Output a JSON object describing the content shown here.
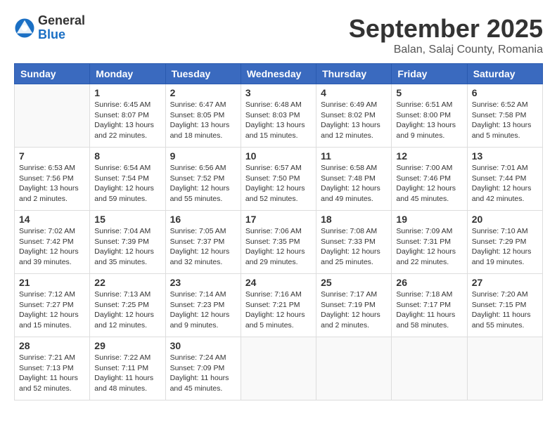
{
  "header": {
    "logo_general": "General",
    "logo_blue": "Blue",
    "month_title": "September 2025",
    "location": "Balan, Salaj County, Romania"
  },
  "days_of_week": [
    "Sunday",
    "Monday",
    "Tuesday",
    "Wednesday",
    "Thursday",
    "Friday",
    "Saturday"
  ],
  "weeks": [
    [
      {
        "day": "",
        "info": ""
      },
      {
        "day": "1",
        "info": "Sunrise: 6:45 AM\nSunset: 8:07 PM\nDaylight: 13 hours\nand 22 minutes."
      },
      {
        "day": "2",
        "info": "Sunrise: 6:47 AM\nSunset: 8:05 PM\nDaylight: 13 hours\nand 18 minutes."
      },
      {
        "day": "3",
        "info": "Sunrise: 6:48 AM\nSunset: 8:03 PM\nDaylight: 13 hours\nand 15 minutes."
      },
      {
        "day": "4",
        "info": "Sunrise: 6:49 AM\nSunset: 8:02 PM\nDaylight: 13 hours\nand 12 minutes."
      },
      {
        "day": "5",
        "info": "Sunrise: 6:51 AM\nSunset: 8:00 PM\nDaylight: 13 hours\nand 9 minutes."
      },
      {
        "day": "6",
        "info": "Sunrise: 6:52 AM\nSunset: 7:58 PM\nDaylight: 13 hours\nand 5 minutes."
      }
    ],
    [
      {
        "day": "7",
        "info": "Sunrise: 6:53 AM\nSunset: 7:56 PM\nDaylight: 13 hours\nand 2 minutes."
      },
      {
        "day": "8",
        "info": "Sunrise: 6:54 AM\nSunset: 7:54 PM\nDaylight: 12 hours\nand 59 minutes."
      },
      {
        "day": "9",
        "info": "Sunrise: 6:56 AM\nSunset: 7:52 PM\nDaylight: 12 hours\nand 55 minutes."
      },
      {
        "day": "10",
        "info": "Sunrise: 6:57 AM\nSunset: 7:50 PM\nDaylight: 12 hours\nand 52 minutes."
      },
      {
        "day": "11",
        "info": "Sunrise: 6:58 AM\nSunset: 7:48 PM\nDaylight: 12 hours\nand 49 minutes."
      },
      {
        "day": "12",
        "info": "Sunrise: 7:00 AM\nSunset: 7:46 PM\nDaylight: 12 hours\nand 45 minutes."
      },
      {
        "day": "13",
        "info": "Sunrise: 7:01 AM\nSunset: 7:44 PM\nDaylight: 12 hours\nand 42 minutes."
      }
    ],
    [
      {
        "day": "14",
        "info": "Sunrise: 7:02 AM\nSunset: 7:42 PM\nDaylight: 12 hours\nand 39 minutes."
      },
      {
        "day": "15",
        "info": "Sunrise: 7:04 AM\nSunset: 7:39 PM\nDaylight: 12 hours\nand 35 minutes."
      },
      {
        "day": "16",
        "info": "Sunrise: 7:05 AM\nSunset: 7:37 PM\nDaylight: 12 hours\nand 32 minutes."
      },
      {
        "day": "17",
        "info": "Sunrise: 7:06 AM\nSunset: 7:35 PM\nDaylight: 12 hours\nand 29 minutes."
      },
      {
        "day": "18",
        "info": "Sunrise: 7:08 AM\nSunset: 7:33 PM\nDaylight: 12 hours\nand 25 minutes."
      },
      {
        "day": "19",
        "info": "Sunrise: 7:09 AM\nSunset: 7:31 PM\nDaylight: 12 hours\nand 22 minutes."
      },
      {
        "day": "20",
        "info": "Sunrise: 7:10 AM\nSunset: 7:29 PM\nDaylight: 12 hours\nand 19 minutes."
      }
    ],
    [
      {
        "day": "21",
        "info": "Sunrise: 7:12 AM\nSunset: 7:27 PM\nDaylight: 12 hours\nand 15 minutes."
      },
      {
        "day": "22",
        "info": "Sunrise: 7:13 AM\nSunset: 7:25 PM\nDaylight: 12 hours\nand 12 minutes."
      },
      {
        "day": "23",
        "info": "Sunrise: 7:14 AM\nSunset: 7:23 PM\nDaylight: 12 hours\nand 9 minutes."
      },
      {
        "day": "24",
        "info": "Sunrise: 7:16 AM\nSunset: 7:21 PM\nDaylight: 12 hours\nand 5 minutes."
      },
      {
        "day": "25",
        "info": "Sunrise: 7:17 AM\nSunset: 7:19 PM\nDaylight: 12 hours\nand 2 minutes."
      },
      {
        "day": "26",
        "info": "Sunrise: 7:18 AM\nSunset: 7:17 PM\nDaylight: 11 hours\nand 58 minutes."
      },
      {
        "day": "27",
        "info": "Sunrise: 7:20 AM\nSunset: 7:15 PM\nDaylight: 11 hours\nand 55 minutes."
      }
    ],
    [
      {
        "day": "28",
        "info": "Sunrise: 7:21 AM\nSunset: 7:13 PM\nDaylight: 11 hours\nand 52 minutes."
      },
      {
        "day": "29",
        "info": "Sunrise: 7:22 AM\nSunset: 7:11 PM\nDaylight: 11 hours\nand 48 minutes."
      },
      {
        "day": "30",
        "info": "Sunrise: 7:24 AM\nSunset: 7:09 PM\nDaylight: 11 hours\nand 45 minutes."
      },
      {
        "day": "",
        "info": ""
      },
      {
        "day": "",
        "info": ""
      },
      {
        "day": "",
        "info": ""
      },
      {
        "day": "",
        "info": ""
      }
    ]
  ]
}
